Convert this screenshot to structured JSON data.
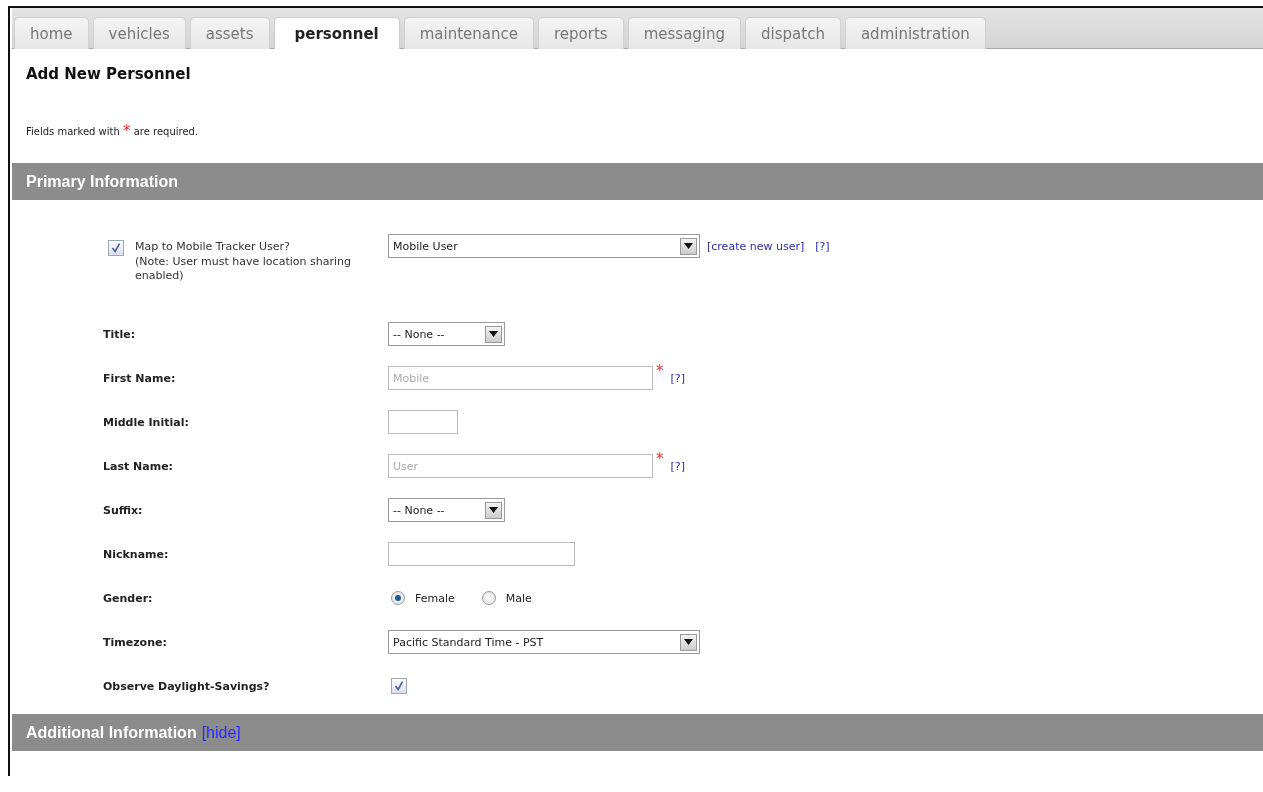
{
  "tabs": [
    {
      "label": "home",
      "selected": false
    },
    {
      "label": "vehicles",
      "selected": false
    },
    {
      "label": "assets",
      "selected": false
    },
    {
      "label": "personnel",
      "selected": true
    },
    {
      "label": "maintenance",
      "selected": false
    },
    {
      "label": "reports",
      "selected": false
    },
    {
      "label": "messaging",
      "selected": false
    },
    {
      "label": "dispatch",
      "selected": false
    },
    {
      "label": "administration",
      "selected": false
    }
  ],
  "page_title": "Add New Personnel",
  "required_note": {
    "before": "Fields marked with",
    "mark": "*",
    "after": "are required."
  },
  "primary_section": {
    "title": "Primary Information",
    "fields": [
      {
        "kind": "mapping",
        "checked": true,
        "label": "Map to Mobile Tracker User?",
        "note": "(Note: User must have location sharing enabled)",
        "value": "Mobile User",
        "links": [
          "[create new user]",
          "[?]"
        ]
      },
      {
        "kind": "select",
        "label": "Title:",
        "value": "-- None --"
      },
      {
        "kind": "text",
        "label": "First Name:",
        "placeholder": "Mobile",
        "required_mark": "*",
        "help": "[?]"
      },
      {
        "kind": "text",
        "label": "Middle Initial:"
      },
      {
        "kind": "text",
        "label": "Last Name:",
        "placeholder": "User",
        "required_mark": "*",
        "help": "[?]"
      },
      {
        "kind": "select",
        "label": "Suffix:",
        "value": "-- None --"
      },
      {
        "kind": "text",
        "label": "Nickname:"
      },
      {
        "kind": "radio",
        "label": "Gender:",
        "options": [
          {
            "label": "Female",
            "selected": true
          },
          {
            "label": "Male",
            "selected": false
          }
        ]
      },
      {
        "kind": "select",
        "label": "Timezone:",
        "value": "Pacific Standard Time - PST"
      },
      {
        "kind": "checkbox",
        "label": "Observe Daylight-Savings?",
        "checked": true
      }
    ]
  },
  "additional_section": {
    "title": "Additional Information",
    "link": "[hide]"
  }
}
